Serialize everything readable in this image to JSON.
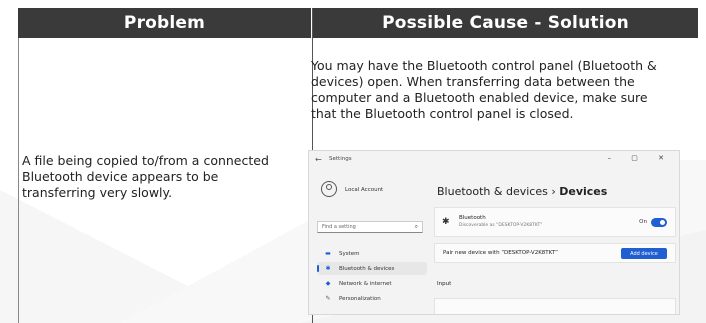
{
  "table": {
    "header_problem": "Problem",
    "header_solution": "Possible Cause - Solution",
    "problem_text": "A file being copied to/from a connected Bluetooth device appears to be transferring very slowly.",
    "solution_text": "You may have the Bluetooth control panel (Bluetooth & devices) open. When transferring data between the computer and a Bluetooth enabled device, make sure that the Bluetooth control panel is closed."
  },
  "settings_window": {
    "back_glyph": "←",
    "title": "Settings",
    "window_controls": "–  ▢  ✕",
    "account": "Local Account",
    "search_placeholder": "Find a setting",
    "search_icon": "⌕",
    "nav": [
      {
        "icon": "▬",
        "label": "System",
        "icon_color": "#1f5fd1"
      },
      {
        "icon": "✱",
        "label": "Bluetooth & devices",
        "icon_color": "#1f5fd1"
      },
      {
        "icon": "◆",
        "label": "Network & internet",
        "icon_color": "#1f5fd1"
      },
      {
        "icon": "✎",
        "label": "Personalization",
        "icon_color": "#555555"
      }
    ],
    "breadcrumb_parent": "Bluetooth & devices",
    "breadcrumb_sep": "›",
    "breadcrumb_current": "Devices",
    "bluetooth_icon": "✱",
    "bluetooth_name": "Bluetooth",
    "bluetooth_desc": "Discoverable as “DESKTOP-V2K8TKT”",
    "toggle_label": "On",
    "pair_text": "Pair new device with “DESKTOP-V2K8TKT”",
    "add_button": "Add device",
    "input_heading": "Input",
    "accent": "#1f5fd1"
  },
  "colors": {
    "header_bg": "#3a3a3a",
    "header_text": "#ffffff"
  }
}
